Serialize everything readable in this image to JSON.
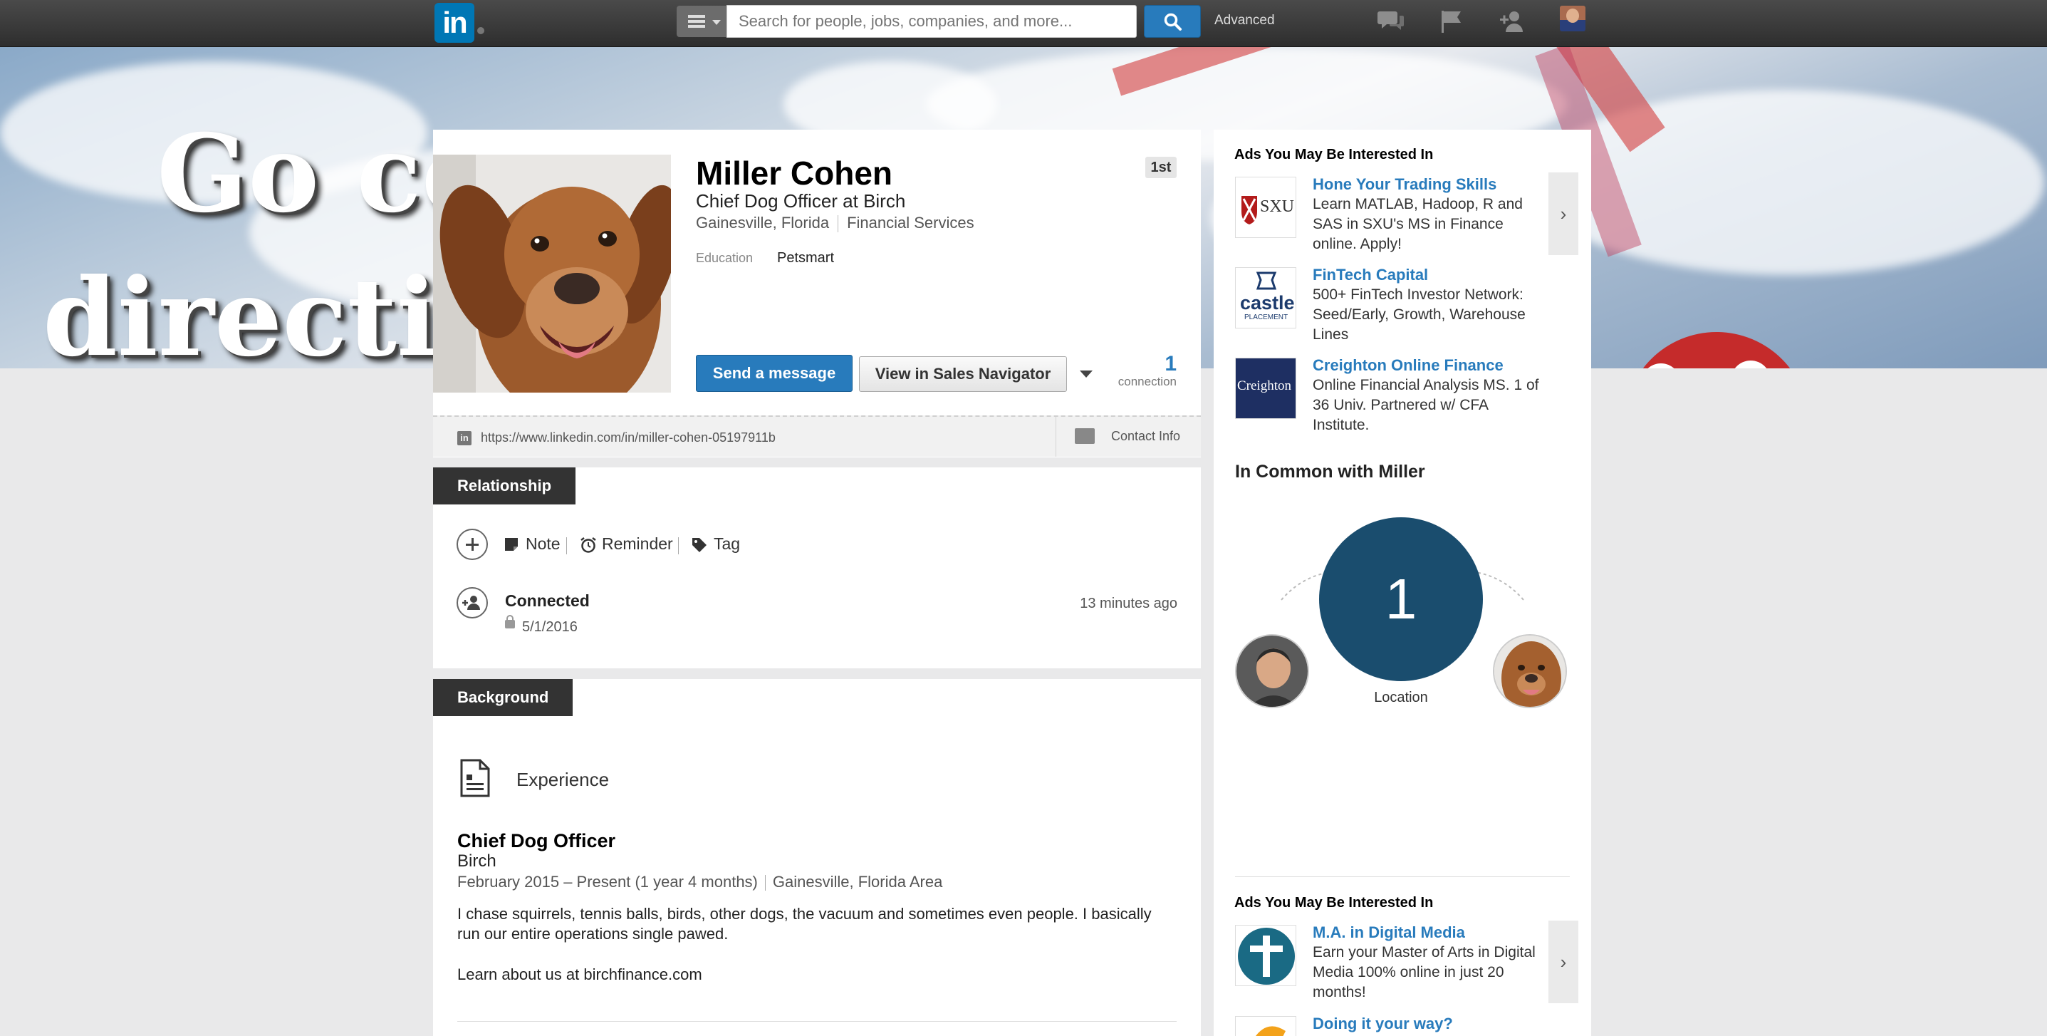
{
  "topbar": {
    "logo_text": "in",
    "search_placeholder": "Search for people, jobs, companies, and more...",
    "advanced_label": "Advanced"
  },
  "banner": {
    "text_line1": "Go co",
    "text_line2": "directio"
  },
  "profile": {
    "name": "Miller Cohen",
    "headline": "Chief Dog Officer at Birch",
    "location": "Gainesville, Florida",
    "industry": "Financial Services",
    "education_label": "Education",
    "education_value": "Petsmart",
    "degree_badge": "1st",
    "send_message": "Send a message",
    "view_sales_navigator": "View in Sales Navigator",
    "connection_count": "1",
    "connection_label": "connection",
    "url_icon_text": "in",
    "profile_url": "https://www.linkedin.com/in/miller-cohen-05197911b",
    "contact_info": "Contact Info"
  },
  "relationship": {
    "tab_label": "Relationship",
    "note": "Note",
    "reminder": "Reminder",
    "tag": "Tag",
    "connected_label": "Connected",
    "connected_date": "5/1/2016",
    "connected_ago": "13 minutes ago"
  },
  "background": {
    "tab_label": "Background",
    "experience_heading": "Experience",
    "job_title": "Chief Dog Officer",
    "job_company": "Birch",
    "job_dates": "February 2015 – Present (1 year 4 months)",
    "job_location": "Gainesville, Florida Area",
    "job_description": "I chase squirrels, tennis balls, birds, other dogs, the vacuum and sometimes even people. I basically run our entire operations single pawed.",
    "job_link_text": "Learn about us at birchfinance.com"
  },
  "rail": {
    "ads_heading_1": "Ads You May Be Interested In",
    "ads": [
      {
        "logo": "SXU",
        "title": "Hone Your Trading Skills",
        "body": "Learn MATLAB, Hadoop, R and SAS in SXU's MS in Finance online. Apply!"
      },
      {
        "logo": "castle",
        "logo_sub": "PLACEMENT",
        "title": "FinTech Capital",
        "body": "500+ FinTech Investor Network: Seed/Early, Growth, Warehouse Lines"
      },
      {
        "logo": "Creighton",
        "title": "Creighton Online Finance",
        "body": "Online Financial Analysis MS. 1 of 36 Univ. Partnered w/ CFA Institute."
      }
    ],
    "next_arrow": "›",
    "common_heading": "In Common with Miller",
    "common_count": "1",
    "common_label": "Location",
    "ads_heading_2": "Ads You May Be Interested In",
    "ads_2": [
      {
        "title": "M.A. in Digital Media",
        "body": "Earn your Master of Arts in Digital Media 100% online in just 20 months!"
      },
      {
        "title": "Doing it your way?",
        "body": ""
      }
    ]
  },
  "colors": {
    "linkedin_blue": "#0077b5",
    "button_blue": "#287bbc",
    "common_circle": "#1a4d6e",
    "section_tab": "#333333"
  }
}
